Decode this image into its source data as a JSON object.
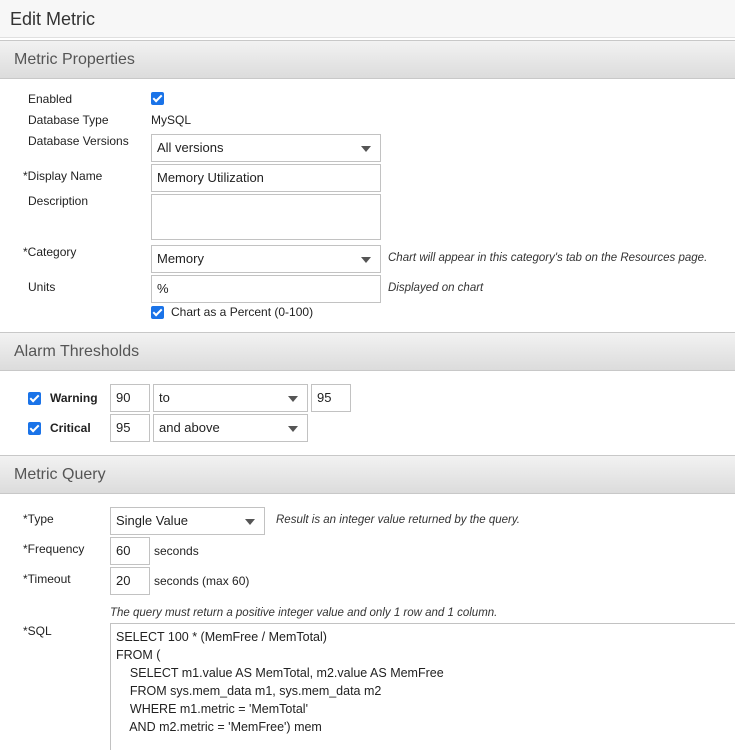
{
  "page": {
    "title": "Edit Metric"
  },
  "sections": {
    "metric_properties": "Metric Properties",
    "alarm_thresholds": "Alarm Thresholds",
    "metric_query": "Metric Query"
  },
  "properties": {
    "enabled": {
      "label": "Enabled",
      "checked": true
    },
    "database_type": {
      "label": "Database Type",
      "value": "MySQL"
    },
    "database_versions": {
      "label": "Database Versions",
      "value": "All versions"
    },
    "display_name": {
      "label": "*Display Name",
      "value": "Memory Utilization"
    },
    "description": {
      "label": "Description",
      "value": ""
    },
    "category": {
      "label": "*Category",
      "value": "Memory",
      "hint": "Chart will appear in this category's tab on the Resources page."
    },
    "units": {
      "label": "Units",
      "value": "%",
      "hint": "Displayed on chart"
    },
    "chart_as_percent": {
      "label": "Chart as a Percent (0-100)",
      "checked": true
    }
  },
  "thresholds": {
    "warning": {
      "label": "Warning",
      "checked": true,
      "value": "90",
      "operator": "to",
      "upper": "95"
    },
    "critical": {
      "label": "Critical",
      "checked": true,
      "value": "95",
      "operator": "and above"
    }
  },
  "query": {
    "type": {
      "label": "*Type",
      "value": "Single Value",
      "hint": "Result is an integer value returned by the query."
    },
    "frequency": {
      "label": "*Frequency",
      "value": "60",
      "unit": "seconds"
    },
    "timeout": {
      "label": "*Timeout",
      "value": "20",
      "unit": "seconds (max 60)"
    },
    "sql_hint": "The query must return a positive integer value and only 1 row and 1 column.",
    "sql_label": "*SQL",
    "sql": "SELECT 100 * (MemFree / MemTotal)\nFROM (\n    SELECT m1.value AS MemTotal, m2.value AS MemFree\n    FROM sys.mem_data m1, sys.mem_data m2\n    WHERE m1.metric = 'MemTotal'\n    AND m2.metric = 'MemFree') mem"
  },
  "colors": {
    "checkbox": "#1a73e8",
    "section_bg": "#e4e4e4",
    "border": "#c2c2c2"
  }
}
